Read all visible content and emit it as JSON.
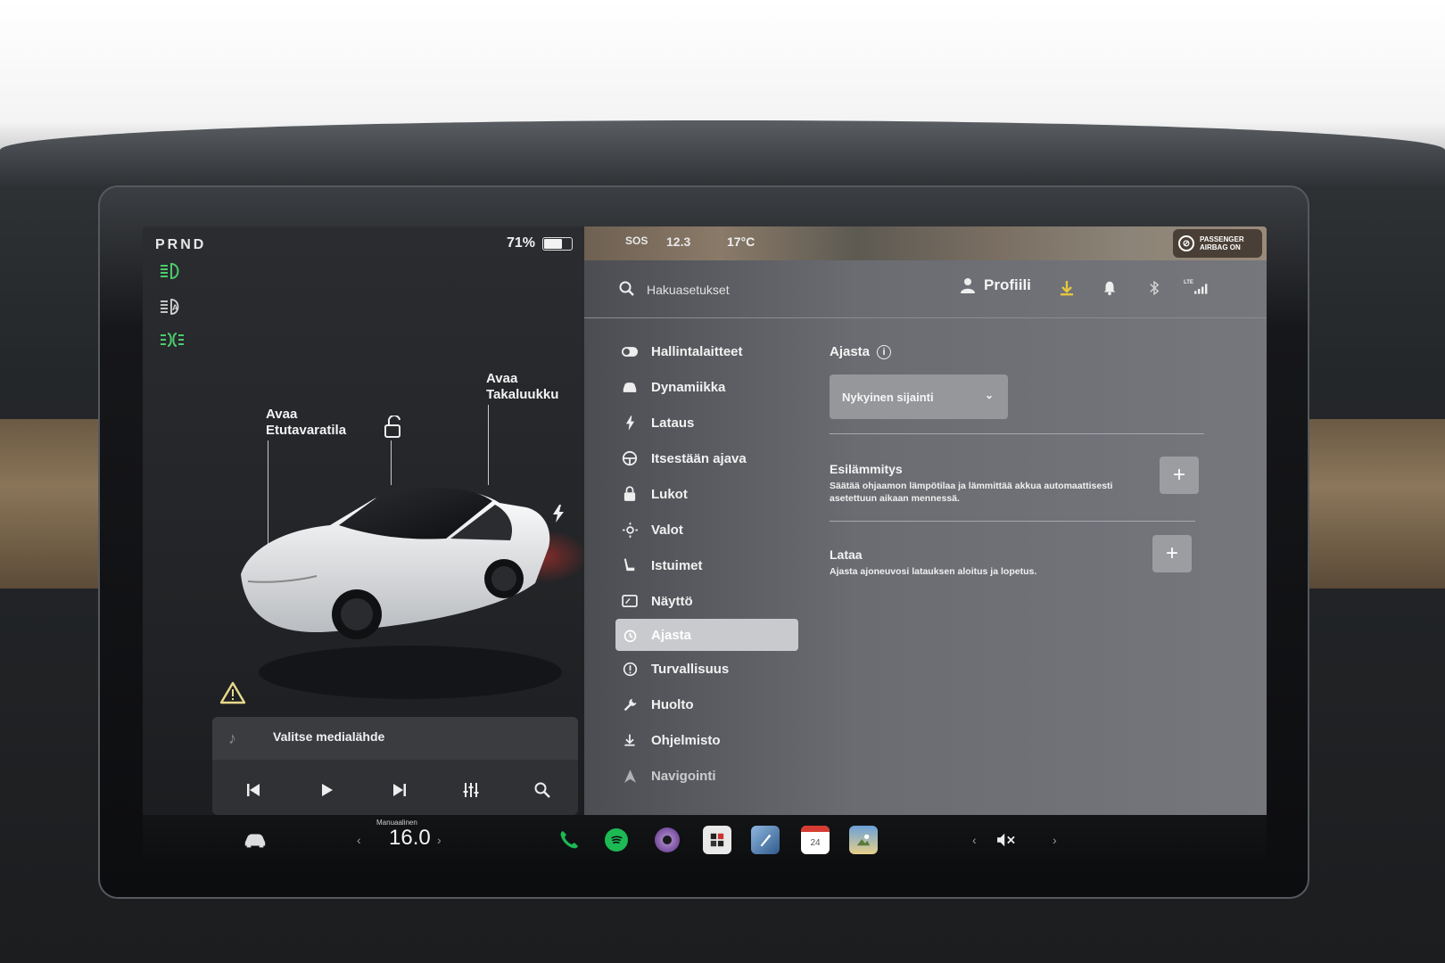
{
  "left_panel": {
    "gear": "PRND",
    "battery_percent": "71%",
    "battery_level": 0.71,
    "frunk_label": "Avaa Etutavaratila",
    "trunk_label": "Avaa Takaluukku",
    "lamp_icons": [
      "headlight-icon",
      "auto-headlight-icon",
      "parking-light-icon"
    ]
  },
  "media": {
    "source_label": "Valitse medialähde",
    "controls": [
      "previous-icon",
      "play-icon",
      "next-icon",
      "equalizer-icon",
      "search-icon"
    ]
  },
  "status_bar": {
    "sos": "SOS",
    "time": "12.3",
    "temperature": "17°C",
    "airbag": "PASSENGER AIRBAG ON"
  },
  "topbar": {
    "search_placeholder": "Hakuasetukset",
    "profile_label": "Profiili",
    "icons": [
      "download-icon",
      "bell-icon",
      "bluetooth-icon",
      "lte-signal-icon"
    ],
    "lte": "LTE"
  },
  "menu": {
    "items": [
      {
        "label": "Hallintalaitteet",
        "icon": "toggle-icon"
      },
      {
        "label": "Dynamiikka",
        "icon": "car-icon"
      },
      {
        "label": "Lataus",
        "icon": "bolt-icon"
      },
      {
        "label": "Itsestään ajava",
        "icon": "steering-wheel-icon"
      },
      {
        "label": "Lukot",
        "icon": "lock-icon"
      },
      {
        "label": "Valot",
        "icon": "light-icon"
      },
      {
        "label": "Istuimet",
        "icon": "seat-icon"
      },
      {
        "label": "Näyttö",
        "icon": "display-icon"
      },
      {
        "label": "Ajasta",
        "icon": "alarm-icon",
        "active": true
      },
      {
        "label": "Turvallisuus",
        "icon": "safety-icon"
      },
      {
        "label": "Huolto",
        "icon": "wrench-icon"
      },
      {
        "label": "Ohjelmisto",
        "icon": "download-icon"
      },
      {
        "label": "Navigointi",
        "icon": "navigation-icon"
      }
    ]
  },
  "content": {
    "title": "Ajasta",
    "dropdown_value": "Nykyinen sijainti",
    "preheat_title": "Esilämmitys",
    "preheat_desc": "Säätää ohjaamon lämpötilaa ja lämmittää akkua automaattisesti asetettuun aikaan mennessä.",
    "charge_title": "Lataa",
    "charge_desc": "Ajasta ajoneuvosi latauksen aloitus ja lopetus."
  },
  "dock": {
    "climate_mode": "Manuaalinen",
    "temperature": "16.0",
    "calendar_day": "24",
    "apps": [
      "car-icon",
      "phone-icon",
      "spotify-icon",
      "camera-icon",
      "toybox-icon",
      "paint-icon",
      "calendar-icon",
      "photos-icon"
    ],
    "volume_icon": "mute-icon"
  },
  "colors": {
    "accent_green": "#4ccb6d",
    "download_yellow": "#e6c640",
    "spotify_green": "#1db954"
  }
}
